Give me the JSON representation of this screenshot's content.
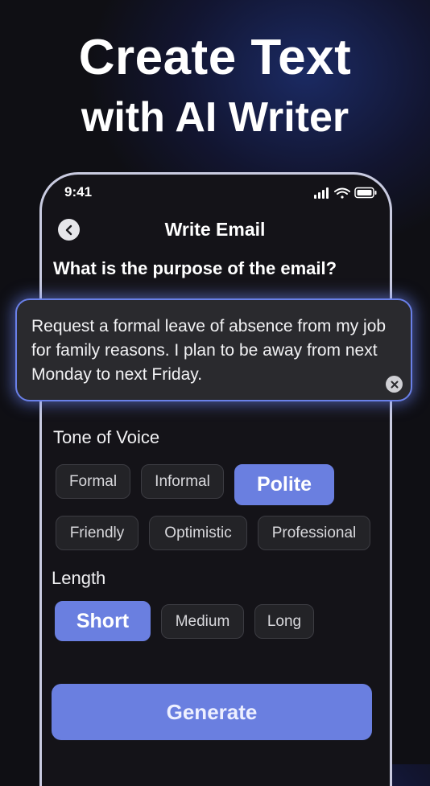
{
  "hero": {
    "line1": "Create Text",
    "line2": "with AI Writer"
  },
  "status_bar": {
    "time": "9:41"
  },
  "screen": {
    "title": "Write Email",
    "question": "What is the purpose of the email?",
    "prompt_text": "Request a formal leave of absence from my job for family reasons. I plan to be away from next Monday to next Friday."
  },
  "tone": {
    "label": "Tone of Voice",
    "options": [
      "Formal",
      "Informal",
      "Polite",
      "Friendly",
      "Optimistic",
      "Professional"
    ],
    "selected": "Polite"
  },
  "length": {
    "label": "Length",
    "options": [
      "Short",
      "Medium",
      "Long"
    ],
    "selected": "Short"
  },
  "generate_label": "Generate",
  "colors": {
    "accent": "#6a7fe0",
    "glow": "#6a80e8",
    "background": "#0f0f14"
  }
}
